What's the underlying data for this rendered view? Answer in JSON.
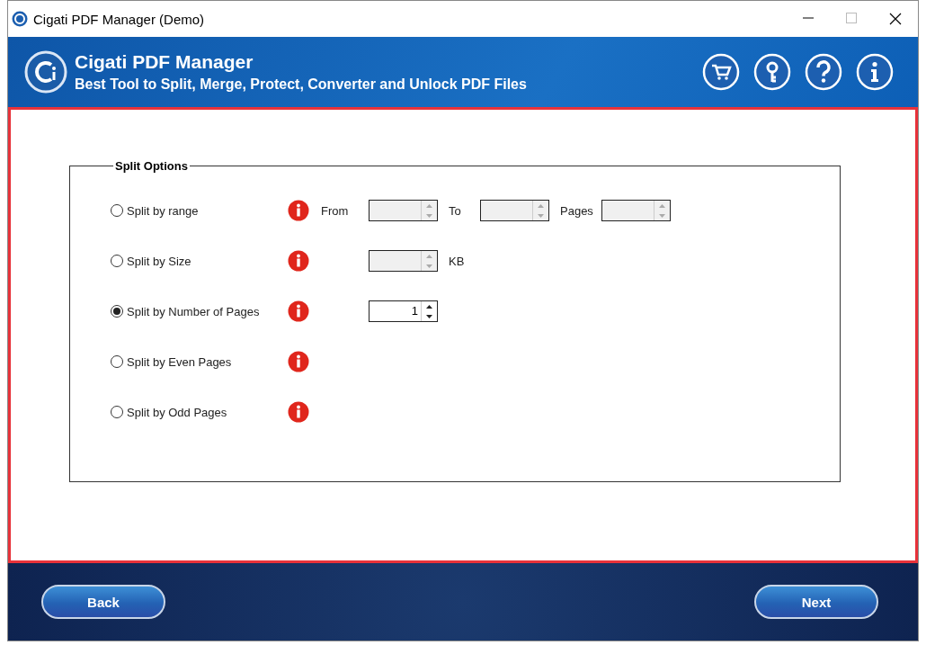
{
  "window": {
    "title": "Cigati PDF Manager (Demo)"
  },
  "header": {
    "title": "Cigati PDF Manager",
    "subtitle": "Best Tool to Split, Merge, Protect, Converter and Unlock PDF Files"
  },
  "split_options": {
    "legend": "Split Options",
    "options": [
      {
        "label": "Split by range",
        "selected": false,
        "fields": [
          {
            "kind": "label",
            "text": "From"
          },
          {
            "kind": "spin",
            "disabled": true
          },
          {
            "kind": "label",
            "text": "To"
          },
          {
            "kind": "spin",
            "disabled": true
          },
          {
            "kind": "label",
            "text": "Pages"
          },
          {
            "kind": "spin",
            "disabled": true
          }
        ]
      },
      {
        "label": "Split by Size",
        "selected": false,
        "fields": [
          {
            "kind": "spin",
            "disabled": true
          },
          {
            "kind": "label",
            "text": "KB"
          }
        ]
      },
      {
        "label": "Split by Number of Pages",
        "selected": true,
        "fields": [
          {
            "kind": "spin",
            "disabled": false,
            "value": "1"
          }
        ]
      },
      {
        "label": "Split by Even Pages",
        "selected": false
      },
      {
        "label": "Split by Odd Pages",
        "selected": false
      }
    ]
  },
  "buttons": [
    {
      "label": "Back"
    },
    {
      "label": "Next"
    }
  ]
}
